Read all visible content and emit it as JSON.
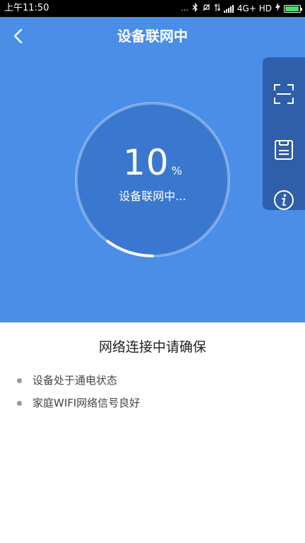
{
  "status_bar": {
    "time": "上午11:50",
    "dots": "...",
    "network": "4G+ HD",
    "battery_level": 0.95
  },
  "header": {
    "title": "设备联网中"
  },
  "progress": {
    "value": "10",
    "unit": "%",
    "fraction": 0.1,
    "status": "设备联网中..."
  },
  "side_menu": {
    "items": [
      {
        "icon": "scan-icon"
      },
      {
        "icon": "save-icon"
      },
      {
        "icon": "info-icon"
      }
    ]
  },
  "tips": {
    "title": "网络连接中请确保",
    "items": [
      "设备处于通电状态",
      "家庭WIFI网络信号良好"
    ]
  },
  "colors": {
    "header_blue": "#4a8ee8",
    "ring_fill": "#3a78d0",
    "side_menu": "#2f5fa8",
    "battery_green": "#4cd964"
  }
}
